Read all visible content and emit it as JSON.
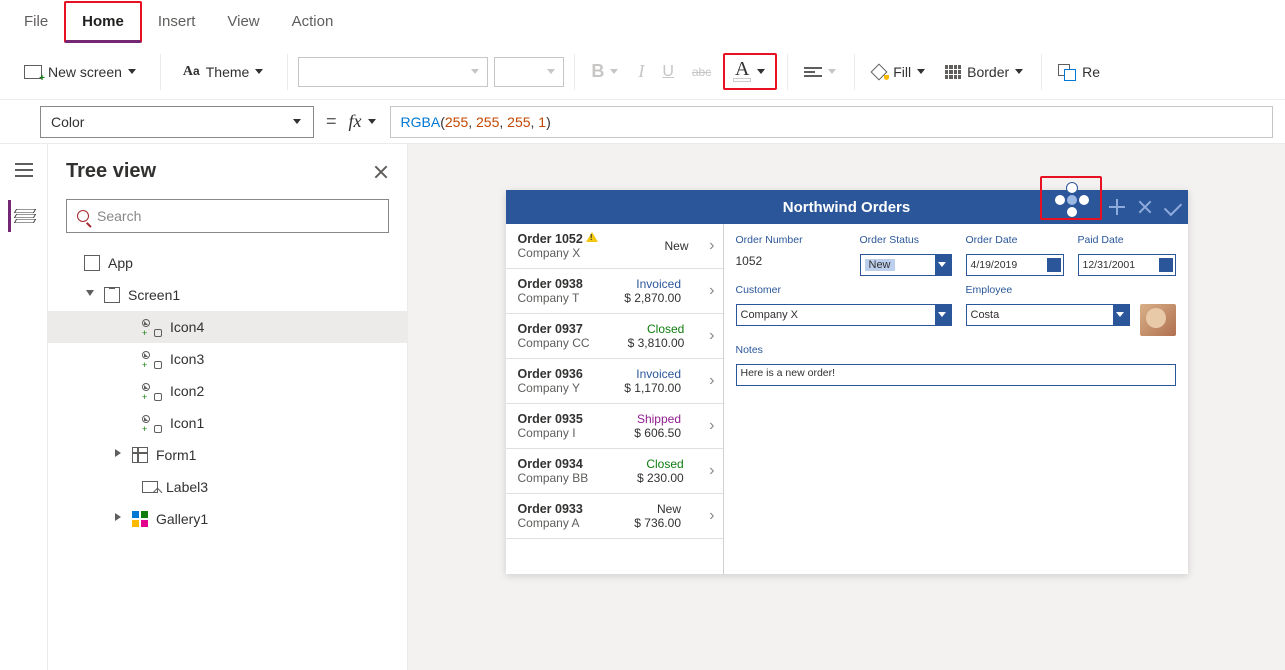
{
  "menu": {
    "tabs": [
      "File",
      "Home",
      "Insert",
      "View",
      "Action"
    ],
    "active": "Home"
  },
  "ribbon": {
    "new_screen": "New screen",
    "theme": "Theme",
    "fill": "Fill",
    "border": "Border",
    "reorder": "Re"
  },
  "formula": {
    "property": "Color",
    "fx": "fx",
    "fn": "RGBA",
    "a1": "255",
    "a2": "255",
    "a3": "255",
    "a4": "1"
  },
  "tree": {
    "title": "Tree view",
    "search_placeholder": "Search",
    "items": [
      {
        "name": "App",
        "kind": "app"
      },
      {
        "name": "Screen1",
        "kind": "screen",
        "expanded": true
      },
      {
        "name": "Icon4",
        "kind": "icon",
        "selected": true
      },
      {
        "name": "Icon3",
        "kind": "icon"
      },
      {
        "name": "Icon2",
        "kind": "icon"
      },
      {
        "name": "Icon1",
        "kind": "icon"
      },
      {
        "name": "Form1",
        "kind": "form",
        "hasChildren": true
      },
      {
        "name": "Label3",
        "kind": "label"
      },
      {
        "name": "Gallery1",
        "kind": "gallery",
        "hasChildren": true
      }
    ]
  },
  "app": {
    "title": "Northwind Orders",
    "orders": [
      {
        "id": "Order 1052",
        "company": "Company X",
        "status": "New",
        "status_class": "st-new",
        "price": "",
        "warn": true
      },
      {
        "id": "Order 0938",
        "company": "Company T",
        "status": "Invoiced",
        "status_class": "st-inv",
        "price": "$ 2,870.00"
      },
      {
        "id": "Order 0937",
        "company": "Company CC",
        "status": "Closed",
        "status_class": "st-cls",
        "price": "$ 3,810.00"
      },
      {
        "id": "Order 0936",
        "company": "Company Y",
        "status": "Invoiced",
        "status_class": "st-inv",
        "price": "$ 1,170.00"
      },
      {
        "id": "Order 0935",
        "company": "Company I",
        "status": "Shipped",
        "status_class": "st-shp",
        "price": "$ 606.50"
      },
      {
        "id": "Order 0934",
        "company": "Company BB",
        "status": "Closed",
        "status_class": "st-cls",
        "price": "$ 230.00"
      },
      {
        "id": "Order 0933",
        "company": "Company A",
        "status": "New",
        "status_class": "st-new",
        "price": "$ 736.00"
      }
    ],
    "detail": {
      "labels": {
        "order_number": "Order Number",
        "order_status": "Order Status",
        "order_date": "Order Date",
        "paid_date": "Paid Date",
        "customer": "Customer",
        "employee": "Employee",
        "notes": "Notes"
      },
      "order_number": "1052",
      "order_status": "New",
      "order_date": "4/19/2019",
      "paid_date": "12/31/2001",
      "customer": "Company X",
      "employee": "Costa",
      "notes": "Here is a new order!"
    }
  }
}
